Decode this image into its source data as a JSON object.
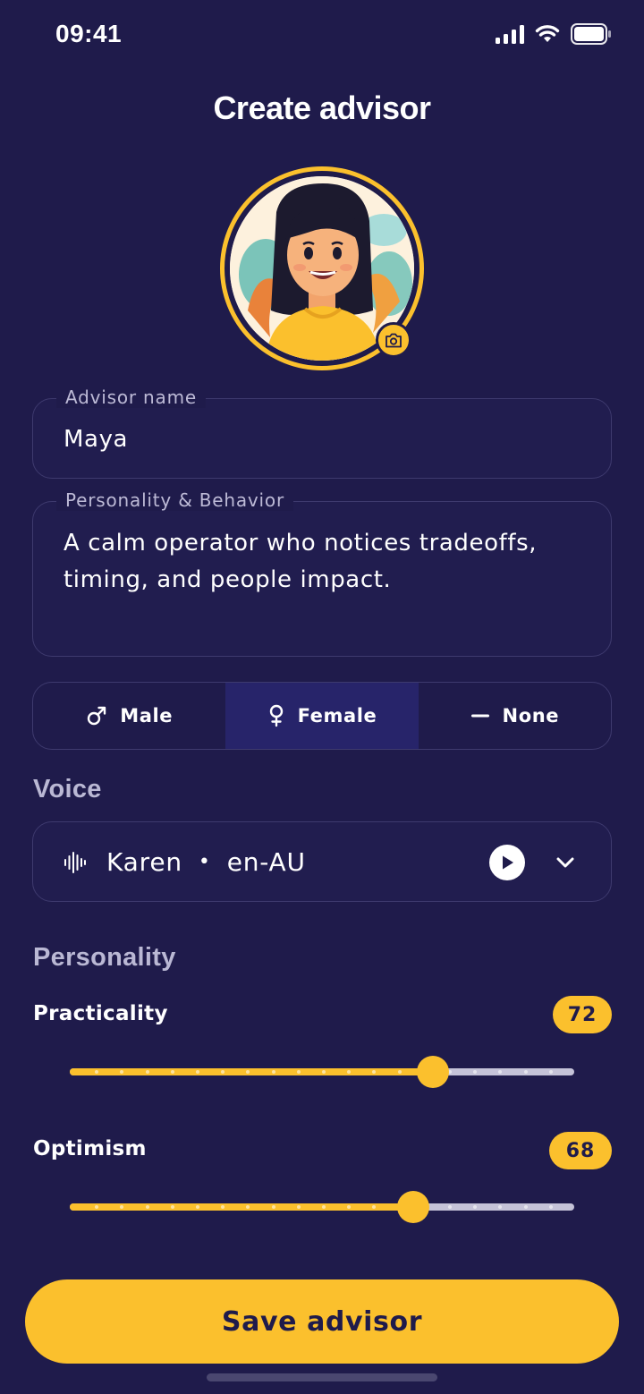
{
  "status_bar": {
    "time": "09:41"
  },
  "header": {
    "title": "Create advisor"
  },
  "avatar": {
    "image": "cartoon-woman-portrait",
    "edit_icon": "camera-icon"
  },
  "form": {
    "name": {
      "label": "Advisor name",
      "value": "Maya"
    },
    "behavior": {
      "label": "Personality & Behavior",
      "value": "A calm operator who notices tradeoffs, timing, and people impact."
    }
  },
  "gender": {
    "options": [
      {
        "label": "Male",
        "icon": "male-icon"
      },
      {
        "label": "Female",
        "icon": "female-icon"
      },
      {
        "label": "None",
        "icon": "dash-icon"
      }
    ],
    "selected": "Female"
  },
  "voice": {
    "section_title": "Voice",
    "name": "Karen",
    "separator": "•",
    "locale": "en-AU",
    "icons": [
      "waveform-icon",
      "play-icon",
      "chevron-down-icon"
    ]
  },
  "personality": {
    "section_title": "Personality",
    "traits": [
      {
        "label": "Practicality",
        "value": "72",
        "level": 0.72
      },
      {
        "label": "Optimism",
        "value": "68",
        "level": 0.68
      }
    ]
  },
  "footer": {
    "save_label": "Save advisor"
  },
  "colors": {
    "background": "#1f1b4b",
    "accent": "#fbc02d",
    "border": "#3e3a6e",
    "selected": "#27246a"
  }
}
